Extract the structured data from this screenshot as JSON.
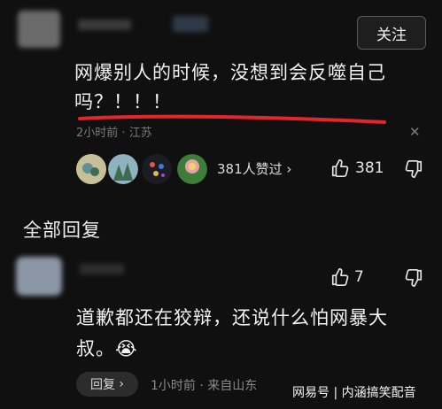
{
  "top_comment": {
    "follow_label": "关注",
    "text_line1": "网爆别人的时候，没想到会反噬自己",
    "text_line2": "吗？！！！",
    "time": "2小时前",
    "location": "江苏",
    "likes_summary": "381人赞过",
    "like_count": "381"
  },
  "replies_section": {
    "title": "全部回复"
  },
  "reply": {
    "like_count": "7",
    "text_line1": "道歉都还在狡辩，还说什么怕网暴大",
    "text_line2": "叔。",
    "emoji": "😭",
    "reply_label": "回复",
    "time": "1小时前",
    "source": "来自山东"
  },
  "watermark": {
    "text": "网易号 | 内涵搞笑配音"
  },
  "colors": {
    "background": "#101010",
    "underline_red": "#e3262b",
    "muted_text": "#7b7b7b"
  }
}
